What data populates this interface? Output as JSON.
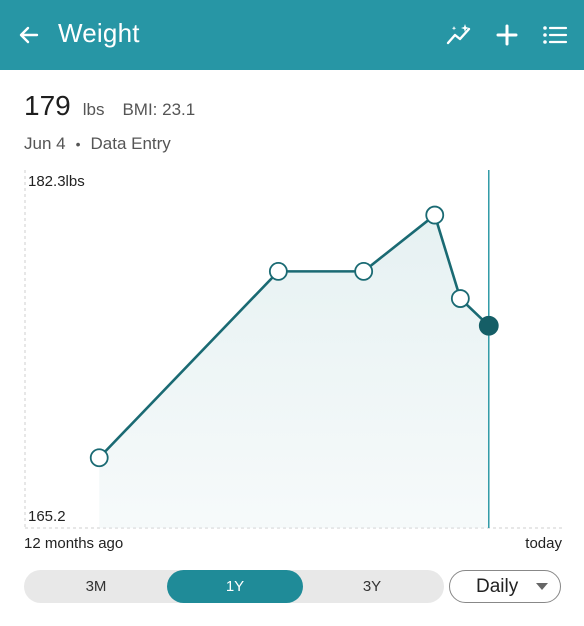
{
  "header": {
    "title": "Weight",
    "icons": {
      "back": "arrow-left-icon",
      "trends": "sparkle-trend-icon",
      "add": "plus-icon",
      "list": "list-icon"
    },
    "color": "#2796a5"
  },
  "summary": {
    "weight": "179",
    "unit": "lbs",
    "bmi": "BMI: 23.1",
    "date": "Jun 4",
    "separator": "•",
    "source": "Data Entry"
  },
  "chart_data": {
    "type": "line",
    "title": "",
    "xlabel": "",
    "ylabel": "",
    "ylim": [
      165.2,
      182.3
    ],
    "ylim_labels": {
      "max": "182.3lbs",
      "min": "165.2"
    },
    "x_start_label": "12 months ago",
    "x_end_label": "today",
    "x_range": [
      -12,
      0
    ],
    "x_unit": "months",
    "series": [
      {
        "x": [
          -11.5,
          -5.2,
          -2.2,
          0.3,
          1.2,
          2.2
        ],
        "y": [
          168.2,
          177.8,
          177.8,
          180.7,
          176.4,
          175.0
        ],
        "selected_index": 5
      }
    ],
    "marker_x": 2.2,
    "line_color": "#1a6a73",
    "fill_color": "#e6f1f2",
    "marker_line_color": "#2f9aa6",
    "grid": false
  },
  "range_selector": {
    "options": [
      "3M",
      "1Y",
      "3Y"
    ],
    "selected": "1Y",
    "accent": "#1f8b98"
  },
  "granularity": {
    "selected": "Daily"
  }
}
